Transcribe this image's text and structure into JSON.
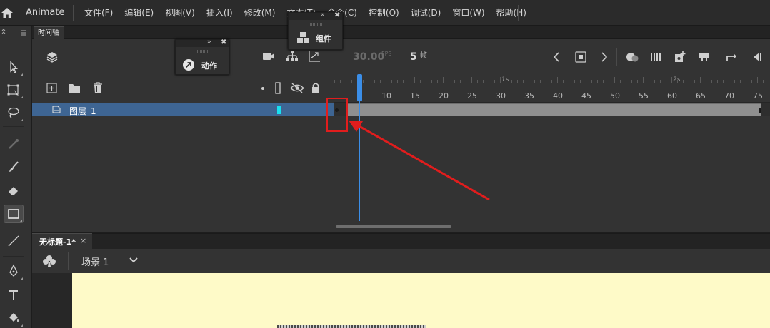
{
  "app": {
    "name": "Animate",
    "menu": [
      "文件(F)",
      "编辑(E)",
      "视图(V)",
      "插入(I)",
      "修改(M)",
      "文本(T)",
      "命令(C)",
      "控制(O)",
      "调试(D)",
      "窗口(W)",
      "帮助(H)"
    ]
  },
  "toolbar": {
    "tools": [
      "select-tool",
      "free-transform-tool",
      "lasso-tool",
      "paint-bucket-tool",
      "brush-tool",
      "eraser-tool",
      "rectangle-tool",
      "line-tool",
      "pen-tool",
      "text-tool",
      "fill-tool"
    ],
    "active": "rectangle-tool"
  },
  "timeline": {
    "tab_label": "时间轴",
    "fps": "30.00",
    "fps_unit": "FPS",
    "current_frame": "5",
    "frame_unit": "帧",
    "ruler_labels": [
      "10",
      "15",
      "20",
      "25",
      "30",
      "35",
      "40",
      "45",
      "50",
      "55",
      "60",
      "65",
      "70",
      "75"
    ],
    "second_labels": [
      "1s",
      "2s"
    ],
    "layers": [
      {
        "name": "图层_1",
        "color": "#19e0f0",
        "selected": true
      }
    ],
    "playhead_frame": 5
  },
  "panels": {
    "actions_label": "动作",
    "components_label": "组件"
  },
  "document": {
    "tab_label": "无标题-1*",
    "close_glyph": "×",
    "scene_label": "场景 1"
  },
  "colors": {
    "accent": "#3b8ee8",
    "annotation": "#e11d1d",
    "stage": "#fefac8",
    "selected_layer": "#3e6593"
  }
}
